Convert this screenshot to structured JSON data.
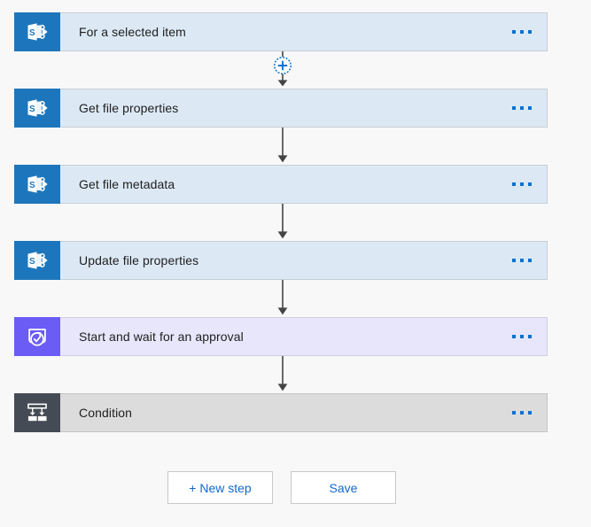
{
  "canvas": {
    "background_color": "#f8f8f8"
  },
  "flow": {
    "steps": [
      {
        "id": "for-a-selected-item",
        "title": "For a selected item",
        "icon": "sharepoint-icon",
        "icon_background": "#1d76bb",
        "card_background": "#dce9f5",
        "menu_label": "..."
      },
      {
        "id": "get-file-properties",
        "title": "Get file properties",
        "icon": "sharepoint-icon",
        "icon_background": "#1d76bb",
        "card_background": "#dce9f5",
        "menu_label": "..."
      },
      {
        "id": "get-file-metadata",
        "title": "Get file metadata",
        "icon": "sharepoint-icon",
        "icon_background": "#1d76bb",
        "card_background": "#dce9f5",
        "menu_label": "..."
      },
      {
        "id": "update-file-properties",
        "title": "Update file properties",
        "icon": "sharepoint-icon",
        "icon_background": "#1d76bb",
        "card_background": "#dce9f5",
        "menu_label": "..."
      },
      {
        "id": "start-and-wait-for-an-approval",
        "title": "Start and wait for an approval",
        "icon": "approval-icon",
        "icon_background": "#6a5cf5",
        "card_background": "#e7e6fb",
        "menu_label": "..."
      },
      {
        "id": "condition",
        "title": "Condition",
        "icon": "condition-icon",
        "icon_background": "#444b55",
        "card_background": "#dcdcdc",
        "menu_label": "..."
      }
    ],
    "connectors": [
      {
        "id": "connector-1",
        "type": "insert-new-step",
        "has_add_button": true,
        "add_label": "+"
      },
      {
        "id": "connector-2",
        "type": "arrow",
        "has_add_button": false
      },
      {
        "id": "connector-3",
        "type": "arrow",
        "has_add_button": false
      },
      {
        "id": "connector-4",
        "type": "arrow",
        "has_add_button": false
      },
      {
        "id": "connector-5",
        "type": "arrow",
        "has_add_button": false
      }
    ],
    "arrow_color": "#444444",
    "add_button_color": "#0b72d0",
    "menu_dot_color": "#0b72d0"
  },
  "actions": {
    "new_step_label": "+ New step",
    "save_label": "Save",
    "link_color": "#1268cf"
  }
}
